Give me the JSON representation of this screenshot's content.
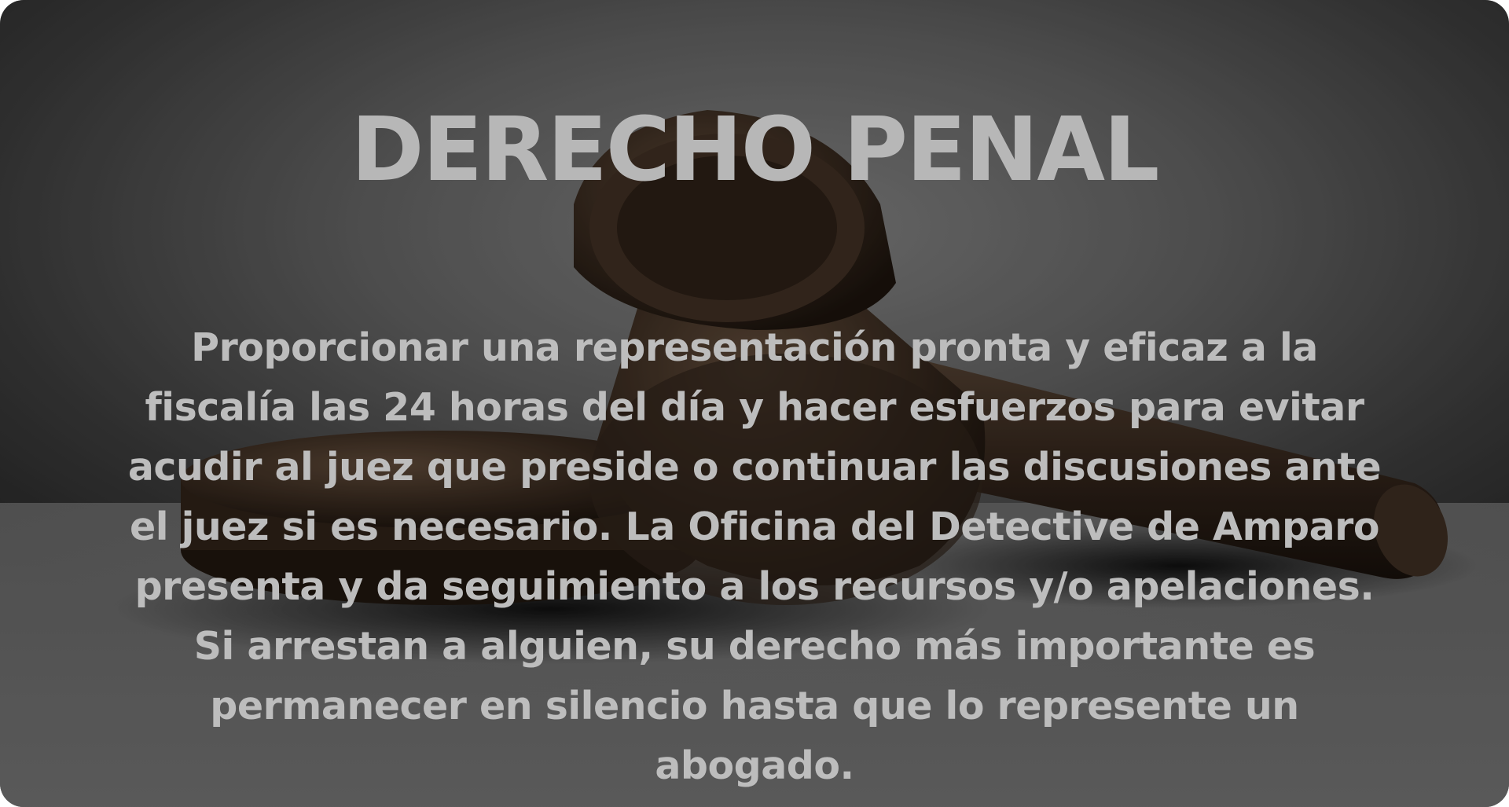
{
  "hero": {
    "title": "DERECHO PENAL",
    "description": "Proporcionar una representación pronta y eficaz a la fiscalía las 24 horas del día y hacer esfuerzos para evitar acudir al juez que preside o continuar las discusiones ante el juez si es necesario. La Oficina del Detective de Amparo presenta y da seguimiento a los recursos y/o apelaciones. Si arrestan a alguien, su derecho más importante es permanecer en silencio hasta que lo represente un abogado.",
    "background_image": "gavel-image"
  },
  "colors": {
    "text": "#bdbdbd",
    "wood_dark": "#2a1f17",
    "wood_mid": "#4a3a2c",
    "background": "#5e5e5e"
  }
}
